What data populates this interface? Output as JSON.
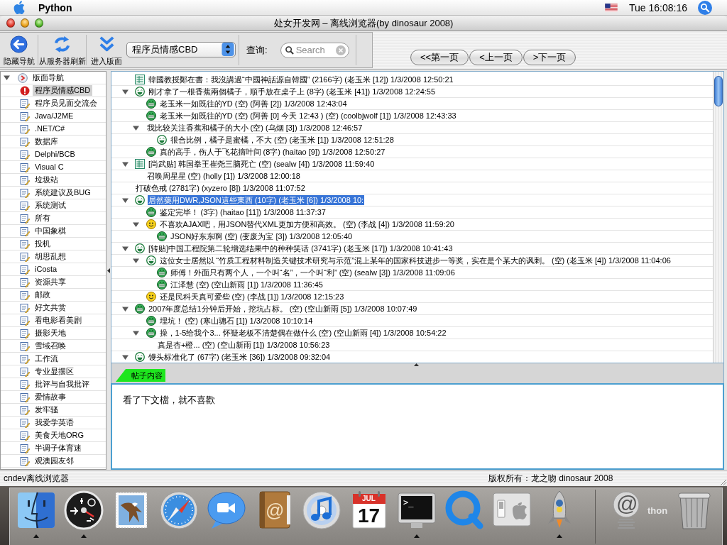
{
  "menu_bar": {
    "app_name": "Python",
    "clock": "Tue 16:08:16"
  },
  "window": {
    "title": "处女开发网 – 离线浏览器(by dinosaur 2008)"
  },
  "toolbar": {
    "buttons": [
      {
        "kind": "back",
        "label": "隐藏导航"
      },
      {
        "kind": "refresh",
        "label": "从服务器刷新"
      },
      {
        "kind": "enter",
        "label": "进入版面"
      }
    ],
    "board_select": {
      "value": "程序员情感CBD"
    },
    "search_label": "查询:",
    "search": {
      "placeholder": "Search"
    },
    "pager": [
      "<<第一页",
      "<上一页",
      ">下一页"
    ]
  },
  "sidebar": {
    "tree": [
      {
        "kind": "navigator",
        "label": "版面导航",
        "selected": false,
        "expanded": true,
        "children": [
          {
            "kind": "alert",
            "label": "程序员情感CBD",
            "selected": true
          },
          {
            "kind": "note",
            "label": "程序员见面交流会",
            "selected": false
          },
          {
            "kind": "note",
            "label": "Java/J2ME",
            "selected": false
          },
          {
            "kind": "note",
            "label": ".NET/C#",
            "selected": false
          },
          {
            "kind": "note",
            "label": "数据库",
            "selected": false
          },
          {
            "kind": "note",
            "label": "Delphi/BCB",
            "selected": false
          },
          {
            "kind": "note",
            "label": "Visual C",
            "selected": false
          },
          {
            "kind": "note",
            "label": "垃圾站",
            "selected": false
          },
          {
            "kind": "note",
            "label": "系统建议及BUG",
            "selected": false
          },
          {
            "kind": "note",
            "label": "系统测试",
            "selected": false
          },
          {
            "kind": "note",
            "label": "所有",
            "selected": false
          },
          {
            "kind": "note",
            "label": "中国象棋",
            "selected": false
          },
          {
            "kind": "note",
            "label": "投机",
            "selected": false
          },
          {
            "kind": "note",
            "label": "胡思乱想",
            "selected": false
          },
          {
            "kind": "note",
            "label": "iCosta",
            "selected": false
          },
          {
            "kind": "note",
            "label": "资源共享",
            "selected": false
          },
          {
            "kind": "note",
            "label": "邮政",
            "selected": false
          },
          {
            "kind": "note",
            "label": "好文共赏",
            "selected": false
          },
          {
            "kind": "note",
            "label": "看电影看美剧",
            "selected": false
          },
          {
            "kind": "note",
            "label": "摄影天地",
            "selected": false
          },
          {
            "kind": "note",
            "label": "雪域召唤",
            "selected": false
          },
          {
            "kind": "note",
            "label": "工作流",
            "selected": false
          },
          {
            "kind": "note",
            "label": "专业显摆区",
            "selected": false
          },
          {
            "kind": "note",
            "label": "批评与自我批评",
            "selected": false
          },
          {
            "kind": "note",
            "label": "爱情故事",
            "selected": false
          },
          {
            "kind": "note",
            "label": "发牢骚",
            "selected": false
          },
          {
            "kind": "note",
            "label": "我爱学英语",
            "selected": false
          },
          {
            "kind": "note",
            "label": "美食天地ORG",
            "selected": false
          },
          {
            "kind": "note",
            "label": "半调子体育迷",
            "selected": false
          },
          {
            "kind": "note",
            "label": "观澳园友邻",
            "selected": false
          }
        ]
      }
    ]
  },
  "thread_tree": {
    "rows": [
      {
        "kind": "board",
        "text": "韓國教授鄭在書：我沒講過“中國神話源自韓國” (2166字) (老玉米 [12]) 1/3/2008 12:50:21",
        "selected": false
      },
      {
        "kind": "laugh",
        "text": "刚才拿了一根香蕉兩個橘子，順手放在桌子上 (8字) (老玉米 [41]) 1/3/2008 12:24:55",
        "selected": false,
        "expanded": true,
        "children": [
          {
            "kind": "teeth",
            "text": "老玉米一如既往的YD (空) (阿善 [2]) 1/3/2008 12:43:04",
            "selected": false
          },
          {
            "kind": "teeth",
            "text": "老玉米一如既往的YD (空) (阿善 [0] 今天 12:43 ) (空) (coolbjwolf [1]) 1/3/2008 12:43:33",
            "selected": false
          },
          {
            "kind": "plain",
            "text": "我比较关注香蕉和橘子的大小 (空) (乌烟 [3]) 1/3/2008 12:46:57",
            "selected": false,
            "expanded": true,
            "children": [
              {
                "kind": "laugh",
                "text": "很合比例，橘子是蜜橘，不大 (空) (老玉米 [1]) 1/3/2008 12:51:28",
                "selected": false
              }
            ]
          },
          {
            "kind": "teeth",
            "text": "真的高手，伤人于飞花摘叶间 (8字) (haitao [9]) 1/3/2008 12:50:27",
            "selected": false
          }
        ]
      },
      {
        "kind": "board",
        "text": "[尚武贴] 韩国拳王崔尧三脑死亡 (空) (sealw [4]) 1/3/2008 11:59:40",
        "selected": false,
        "expanded": true,
        "children": [
          {
            "kind": "plain",
            "text": "召唤周星星 (空) (holly [1]) 1/3/2008 12:00:18",
            "selected": false
          }
        ]
      },
      {
        "kind": "plain",
        "text": "打破色戒 (2781字) (xyzero [8]) 1/3/2008 11:07:52",
        "selected": false
      },
      {
        "kind": "laugh",
        "text": "居然藥用DWR,JSON這些東西 (10字) (老玉米 [6]) 1/3/2008 10:",
        "selected": true,
        "expanded": true,
        "children": [
          {
            "kind": "teeth",
            "text": "鉴定完毕！ (3字) (haitao [11]) 1/3/2008 11:37:37",
            "selected": false
          },
          {
            "kind": "smile",
            "text": "不喜欢AJAX吧，用JSON替代XML更加方便和高效。 (空) (李战 [4]) 1/3/2008 11:59:20",
            "selected": false,
            "expanded": true,
            "children": [
              {
                "kind": "teeth",
                "text": "JSON好东东啊 (空) (变废为宝 [3]) 1/3/2008 12:05:40",
                "selected": false
              }
            ]
          }
        ]
      },
      {
        "kind": "laugh",
        "text": "[转贴]中国工程院第二轮增选结果中的种种笑话 (3741字) (老玉米 [17]) 1/3/2008 10:41:43",
        "selected": false,
        "expanded": true,
        "children": [
          {
            "kind": "laugh",
            "text": "这位女士居然以 “竹质工程材料制造关键技术研究与示范”混上某年的国家科技进步一等奖，实在是个某大的讽刺。 (空) (老玉米 [4]) 1/3/2008 11:04:06",
            "selected": false,
            "expanded": true,
            "children": [
              {
                "kind": "teeth",
                "text": "师傅！外面只有两个人，一个叫“名”，一个叫“利” (空) (sealw [3]) 1/3/2008 11:09:06",
                "selected": false
              },
              {
                "kind": "teeth",
                "text": "江泽慧 (空) (空山新雨 [1]) 1/3/2008 11:36:45",
                "selected": false
              }
            ]
          },
          {
            "kind": "smile",
            "text": "还是民科天真可爱些 (空) (李战 [1]) 1/3/2008 12:15:23",
            "selected": false
          }
        ]
      },
      {
        "kind": "teeth",
        "text": "2007年度总结1分钟后开始，挖坑占标。 (空) (空山新雨 [5]) 1/3/2008 10:07:49",
        "selected": false,
        "expanded": true,
        "children": [
          {
            "kind": "teeth",
            "text": "埋坑！ (空) (寒山骢石 [1]) 1/3/2008 10:10:14",
            "selected": false
          },
          {
            "kind": "teeth",
            "text": "操，1-5给我个3... 怀疑老板不清楚偶在做什么 (空) (空山新雨 [4]) 1/3/2008 10:54:22",
            "selected": false,
            "expanded": true,
            "children": [
              {
                "kind": "plain",
                "text": "真是杏+橙... (空) (空山新雨 [1]) 1/3/2008 10:56:23",
                "selected": false
              }
            ]
          }
        ]
      },
      {
        "kind": "laugh",
        "text": "馒头标准化了 (67字) (老玉米 [36]) 1/3/2008 09:32:04",
        "selected": false,
        "expanded": true
      }
    ]
  },
  "content_tabs": [
    {
      "label": "帖子内容",
      "selected": true
    }
  ],
  "post_body": "看了下文檔，就不喜歡",
  "status_bar": {
    "left": "cndev离线浏览器",
    "right": "版权所有：龙之吻 dinosaur 2008"
  },
  "dock": {
    "apps": [
      {
        "kind": "finder",
        "running": true
      },
      {
        "kind": "dashboard",
        "running": true
      },
      {
        "kind": "mail",
        "running": false
      },
      {
        "kind": "safari",
        "running": false
      },
      {
        "kind": "ichat",
        "running": false
      },
      {
        "kind": "addressbook",
        "glyph": "@",
        "running": false
      },
      {
        "kind": "itunes",
        "running": false
      },
      {
        "kind": "calendar",
        "month": "JUL",
        "day": "17",
        "running": false
      },
      {
        "kind": "terminal",
        "prompt": ">_",
        "running": true
      },
      {
        "kind": "quicktime",
        "running": false
      },
      {
        "kind": "preferences",
        "running": false
      },
      {
        "kind": "python",
        "running": true
      }
    ],
    "extras": [
      {
        "kind": "internet",
        "glyph": "@",
        "label": "thon"
      },
      {
        "kind": "trash"
      }
    ]
  }
}
